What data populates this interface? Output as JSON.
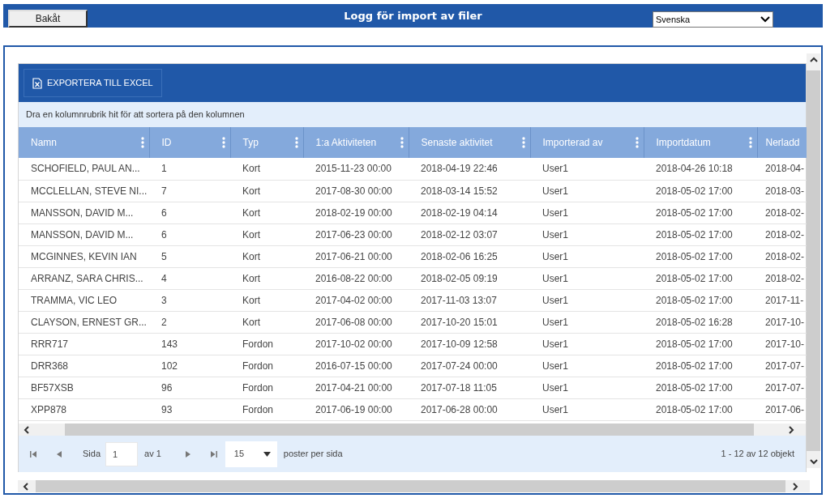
{
  "header": {
    "back_button": "Bakåt",
    "title": "Logg för import av filer",
    "language": "Svenska"
  },
  "grid": {
    "export_button": "EXPORTERA TILL EXCEL",
    "group_hint": "Dra en kolumnrubrik hit för att sortera på den kolumnen",
    "columns": [
      "Namn",
      "ID",
      "Typ",
      "1:a Aktiviteten",
      "Senaste aktivitet",
      "Importerad av",
      "Importdatum",
      "Nerladd"
    ],
    "rows": [
      [
        "SCHOFIELD, PAUL AN...",
        "1",
        "Kort",
        "2015-11-23 00:00",
        "2018-04-19 22:46",
        "User1",
        "2018-04-26 10:18",
        "2018-04-"
      ],
      [
        "MCCLELLAN, STEVE NI...",
        "7",
        "Kort",
        "2017-08-30 00:00",
        "2018-03-14 15:52",
        "User1",
        "2018-05-02 17:00",
        "2018-03-"
      ],
      [
        "MANSSON, DAVID M...",
        "6",
        "Kort",
        "2018-02-19 00:00",
        "2018-02-19 04:14",
        "User1",
        "2018-05-02 17:00",
        "2018-02-"
      ],
      [
        "MANSSON, DAVID M...",
        "6",
        "Kort",
        "2017-06-23 00:00",
        "2018-02-12 03:07",
        "User1",
        "2018-05-02 17:00",
        "2018-02-"
      ],
      [
        "MCGINNES, KEVIN IAN",
        "5",
        "Kort",
        "2017-06-21 00:00",
        "2018-02-06 16:25",
        "User1",
        "2018-05-02 17:00",
        "2018-02-"
      ],
      [
        "ARRANZ, SARA CHRIS...",
        "4",
        "Kort",
        "2016-08-22 00:00",
        "2018-02-05 09:19",
        "User1",
        "2018-05-02 17:00",
        "2018-02-"
      ],
      [
        "TRAMMA, VIC LEO",
        "3",
        "Kort",
        "2017-04-02 00:00",
        "2017-11-03 13:07",
        "User1",
        "2018-05-02 17:00",
        "2017-11-"
      ],
      [
        "CLAYSON, ERNEST GR...",
        "2",
        "Kort",
        "2017-06-08 00:00",
        "2017-10-20 15:01",
        "User1",
        "2018-05-02 16:28",
        "2017-10-"
      ],
      [
        "RRR717",
        "143",
        "Fordon",
        "2017-10-02 00:00",
        "2017-10-09 12:58",
        "User1",
        "2018-05-02 17:00",
        "2017-10-"
      ],
      [
        "DRR368",
        "102",
        "Fordon",
        "2016-07-15 00:00",
        "2017-07-24 00:00",
        "User1",
        "2018-05-02 17:00",
        "2017-07-"
      ],
      [
        "BF57XSB",
        "96",
        "Fordon",
        "2017-04-21 00:00",
        "2017-07-18 11:05",
        "User1",
        "2018-05-02 17:00",
        "2017-07-"
      ],
      [
        "XPP878",
        "93",
        "Fordon",
        "2017-06-19 00:00",
        "2017-06-28 00:00",
        "User1",
        "2018-05-02 17:00",
        "2017-06-"
      ]
    ]
  },
  "pager": {
    "page_label": "Sida",
    "page_value": "1",
    "of_label": "av 1",
    "page_size": "15",
    "per_page_label": "poster per sida",
    "summary": "1 - 12 av 12 objekt"
  }
}
